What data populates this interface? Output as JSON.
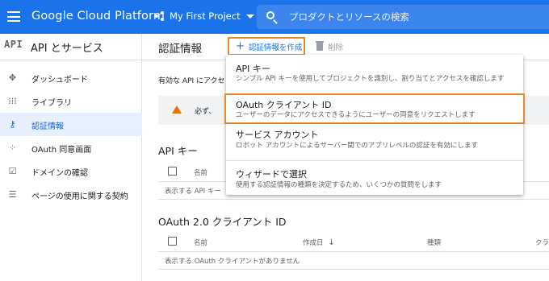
{
  "topbar": {
    "brand": "Google Cloud Platform",
    "project": "My First Project",
    "search_placeholder": "プロダクトとリソースの検索"
  },
  "sidebar": {
    "badge": "API",
    "title": "API とサービス",
    "items": [
      {
        "label": "ダッシュボード",
        "icon": "dashboard-icon",
        "glyph": "✥",
        "active": false
      },
      {
        "label": "ライブラリ",
        "icon": "library-icon",
        "glyph": "⁞⁞⁞",
        "active": false
      },
      {
        "label": "認証情報",
        "icon": "key-icon",
        "glyph": "⚷",
        "active": true
      },
      {
        "label": "OAuth 同意画面",
        "icon": "consent-icon",
        "glyph": "⁘",
        "active": false
      },
      {
        "label": "ドメインの確認",
        "icon": "checkbox-icon",
        "glyph": "☑",
        "active": false
      },
      {
        "label": "ページの使用に関する契約",
        "icon": "settings-list-icon",
        "glyph": "☰",
        "active": false
      }
    ]
  },
  "main": {
    "title": "認証情報",
    "create_label": "認証情報を作成",
    "delete_label": "削除",
    "info_line": "有効な API にアクセ",
    "warning_text": "必ず、",
    "api_keys": {
      "title": "API キー",
      "col_name": "名前",
      "empty": "表示する API キー"
    },
    "oauth": {
      "title": "OAuth 2.0 クライアント ID",
      "col_name": "名前",
      "col_created": "作成日",
      "col_type": "種類",
      "col_client": "クラ",
      "empty": "表示する OAuth クライアントがありません"
    }
  },
  "menu": {
    "items": [
      {
        "title": "API キー",
        "desc": "シンプル API キーを使用してプロジェクトを識別し、割り当てとアクセスを確認します"
      },
      {
        "title": "OAuth クライアント ID",
        "desc": "ユーザーのデータにアクセスできるようにユーザーの同意をリクエストします"
      },
      {
        "title": "サービス アカウント",
        "desc": "ロボット アカウントによるサーバー間でのアプリレベルの認証を有効にします"
      },
      {
        "title": "ウィザードで選択",
        "desc": "使用する認証情報の種類を決定するため、いくつかの質問をします"
      }
    ]
  },
  "colors": {
    "brand_blue": "#1a73e8",
    "highlight_orange": "#e8892e",
    "active_bg": "#e8f0fe",
    "warning": "#e37400"
  }
}
